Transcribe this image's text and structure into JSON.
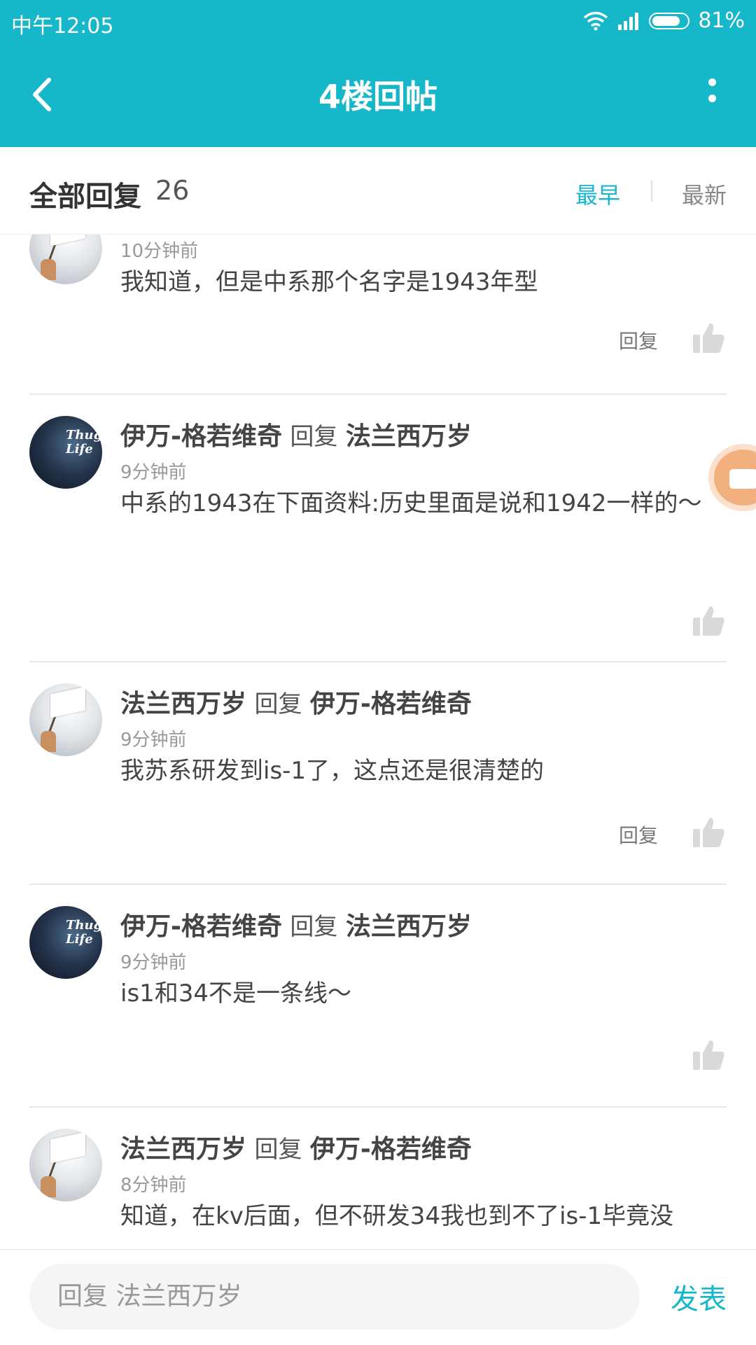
{
  "status_bar": {
    "time": "中午12:05",
    "battery": "81%",
    "battery_level": 0.81
  },
  "app_bar": {
    "title": "4楼回帖"
  },
  "replies_header": {
    "label": "全部回复",
    "count": "26",
    "sort_earliest": "最早",
    "sort_latest": "最新"
  },
  "comments": [
    {
      "user": "",
      "reply_word": "",
      "target": "",
      "time": "10分钟前",
      "content": "我知道，但是中系那个名字是1943年型",
      "reply_label": "回复"
    },
    {
      "user": "伊万-格若维奇",
      "reply_word": "回复",
      "target": "法兰西万岁",
      "time": "9分钟前",
      "content": "中系的1943在下面资料:历史里面是说和1942一样的～",
      "reply_label": ""
    },
    {
      "user": "法兰西万岁",
      "reply_word": "回复",
      "target": "伊万-格若维奇",
      "time": "9分钟前",
      "content": "我苏系研发到is-1了，这点还是很清楚的",
      "reply_label": "回复"
    },
    {
      "user": "伊万-格若维奇",
      "reply_word": "回复",
      "target": "法兰西万岁",
      "time": "9分钟前",
      "content": "is1和34不是一条线～",
      "reply_label": ""
    },
    {
      "user": "法兰西万岁",
      "reply_word": "回复",
      "target": "伊万-格若维奇",
      "time": "8分钟前",
      "content": "知道，在kv后面，但不研发34我也到不了is-1毕竟没",
      "reply_label": ""
    }
  ],
  "avatar_text": {
    "thug_line1": "Thug",
    "thug_line2": "Life"
  },
  "bottom_bar": {
    "placeholder": "回复 法兰西万岁",
    "publish": "发表"
  },
  "colors": {
    "accent": "#16b7c8",
    "float_button": "#f2b07f"
  },
  "icons": [
    "back-arrow-icon",
    "more-vertical-icon",
    "wifi-icon",
    "signal-icon",
    "battery-icon",
    "thumbs-up-icon",
    "video-camera-icon"
  ]
}
